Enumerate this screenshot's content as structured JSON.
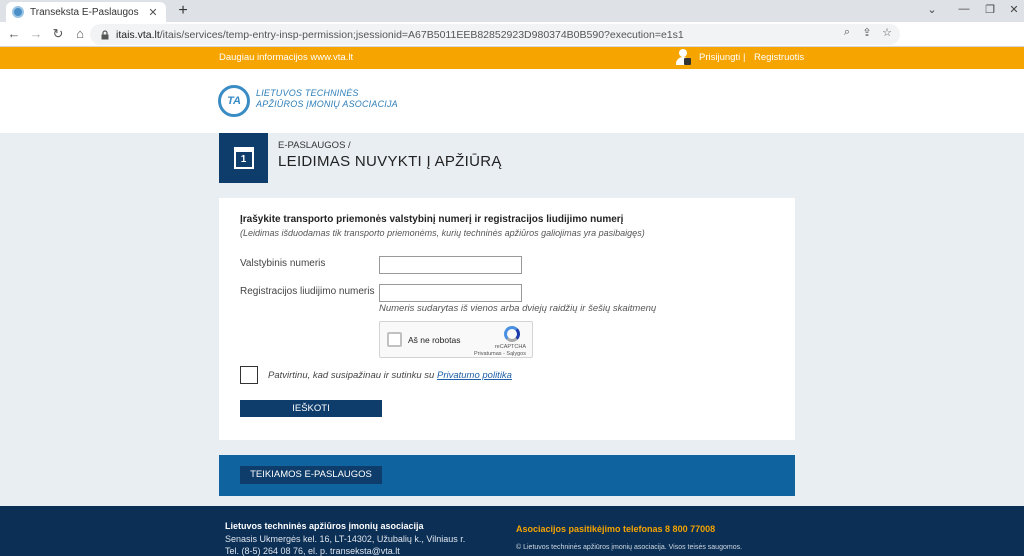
{
  "browser": {
    "tab_title": "Transeksta E-Paslaugos",
    "tab_close": "✕",
    "new_tab": "+",
    "url_host": "itais.vta.lt",
    "url_path": "/itais/services/temp-entry-insp-permission;jsessionid=A67B5011EEB82852923D980374B0B590?execution=e1s1",
    "nav_back": "←",
    "nav_forward": "→",
    "nav_reload": "↻",
    "nav_home": "⌂",
    "lock_glyph": "🔒",
    "zoom_glyph": "⌕",
    "share_glyph": "⇪",
    "star_glyph": "☆",
    "minimize": "⌄",
    "minimize2": "—",
    "restore": "❐",
    "close": "✕"
  },
  "topbar": {
    "more_info": "Daugiau informacijos www.vta.lt",
    "login": "Prisijungti",
    "separator": "|",
    "register": "Registruotis",
    "color": "#f5a400"
  },
  "header": {
    "logo_abbr": "TA",
    "logo_line1": "LIETUVOS TECHNINĖS",
    "logo_line2": "APŽIŪROS ĮMONIŲ ASOCIACIJA"
  },
  "page": {
    "calendar_day": "1",
    "breadcrumb": "E-PASLAUGOS /",
    "title": "LEIDIMAS NUVYKTI Į APŽIŪRĄ"
  },
  "form": {
    "heading": "Įrašykite transporto priemonės valstybinį numerį ir registracijos liudijimo numerį",
    "note": "(Leidimas išduodamas tik transporto priemonėms, kurių techninės apžiūros galiojimas yra pasibaigęs)",
    "plate_label": "Valstybinis numeris",
    "plate_value": "",
    "reg_label": "Registracijos liudijimo numeris",
    "reg_value": "",
    "reg_hint": "Numeris sudarytas iš vienos arba dviejų raidžių ir šešių skaitmenų",
    "captcha_label": "Aš ne robotas",
    "captcha_brand": "reCAPTCHA",
    "captcha_links": "Privatumas - Sąlygos",
    "agree_text": "Patvirtinu, kad susipažinau ir sutinku su",
    "agree_link": "Privatumo politika",
    "search_button": "IEŠKOTI"
  },
  "services": {
    "button": "TEIKIAMOS E-PASLAUGOS"
  },
  "footer": {
    "org": "Lietuvos techninės apžiūros įmonių asociacija",
    "address": "Senasis Ukmergės kel. 16, LT-14302, Užubalių k., Vilniaus r.",
    "contact": "Tel. (8-5) 264 08 76, el. p. transeksta@vta.lt",
    "hotline": "Asociacijos pasitikėjimo telefonas 8 800 77008",
    "copyright": "© Lietuvos techninės apžiūros įmonių asociacija. Visos teisės saugomos."
  },
  "colors": {
    "navy": "#0e3d6b",
    "blue_band": "#0f64a0",
    "footer": "#0c2f55",
    "accent": "#f5a400"
  }
}
